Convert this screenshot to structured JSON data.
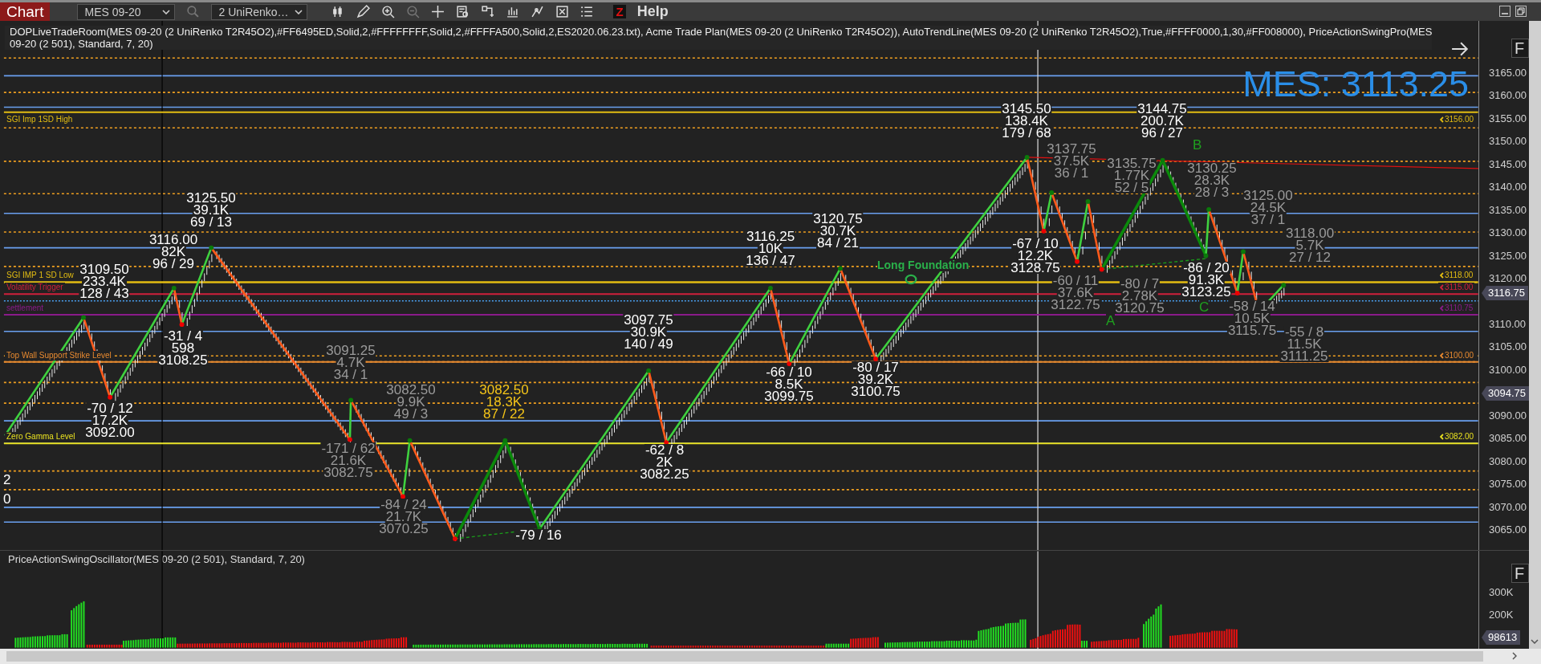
{
  "toolbar": {
    "tab": "Chart",
    "instrument": "MES 09-20",
    "bar_type": "2 UniRenko…",
    "z_logo": "Z",
    "help": "Help"
  },
  "indicator_lines": [
    "DOPLiveTradeRoom(MES 09-20 (2 UniRenko T2R45O2),#FF6495ED,Solid,2,#FFFFFFFF,Solid,2,#FFFFA500,Solid,2,ES2020.06.23.txt), Acme Trade Plan(MES 09-20 (2 UniRenko T2R45O2)), AutoTrendLine(MES 09-20 (2 UniRenko T2R45O2),True,#FFFF0000,1,30,#FF008000), PriceActionSwingPro(MES",
    "09-20 (2 501), Standard, 7, 20)"
  ],
  "price_banner": "MES: 3113.25",
  "levels": [
    {
      "label": "SGI Imp 1SD High",
      "tag": "3156.00",
      "color": "#e3bd12"
    },
    {
      "label": "SGI IMP 1 SD Low",
      "tag": "3118.00",
      "color": "#e3bd12"
    },
    {
      "label": "Volatility Trigger",
      "tag": "3115.00",
      "color": "#d0203c"
    },
    {
      "label": "settlement",
      "tag": "3110.75",
      "color": "#8a1a8a"
    },
    {
      "label": "Top Wall Support Strike Level",
      "tag": "3100.00",
      "color": "#e88a30"
    },
    {
      "label": "Zero Gamma Level",
      "tag": "3082.00",
      "color": "#e8e020"
    }
  ],
  "swing_labels": [
    {
      "kind": "bright",
      "lines": [
        "3109.50",
        "233.4K",
        "128 / 43"
      ]
    },
    {
      "kind": "bright",
      "lines": [
        "3116.00",
        "82K",
        "96 / 29"
      ]
    },
    {
      "kind": "bright",
      "lines": [
        "3125.50",
        "39.1K",
        "69 / 13"
      ]
    },
    {
      "kind": "bright",
      "lines": [
        "-31 / 4",
        "598",
        "3108.25"
      ]
    },
    {
      "kind": "bright",
      "lines": [
        "-70 / 12",
        "17.2K",
        "3092.00"
      ]
    },
    {
      "kind": "dim",
      "lines": [
        "3091.25",
        "4.7K",
        "34 / 1"
      ]
    },
    {
      "kind": "dim",
      "lines": [
        "3082.50",
        "9.9K",
        "49 / 3"
      ]
    },
    {
      "kind": "accent",
      "lines": [
        "3082.50",
        "18.3K",
        "87 / 22"
      ]
    },
    {
      "kind": "dim",
      "lines": [
        "-171 / 62",
        "21.6K",
        "3082.75"
      ]
    },
    {
      "kind": "dim",
      "lines": [
        "-84 / 24",
        "21.7K",
        "3070.25"
      ]
    },
    {
      "kind": "bright",
      "lines": [
        "-79 / 16"
      ]
    },
    {
      "kind": "bright",
      "lines": [
        "3097.75",
        "30.9K",
        "140 / 49"
      ]
    },
    {
      "kind": "bright",
      "lines": [
        "-62 / 8",
        "2K",
        "3082.25"
      ]
    },
    {
      "kind": "bright",
      "lines": [
        "3116.25",
        "10K",
        "136 / 47"
      ]
    },
    {
      "kind": "bright",
      "lines": [
        "3120.75",
        "30.7K",
        "84 / 21"
      ]
    },
    {
      "kind": "bright",
      "lines": [
        "-66 / 10",
        "8.5K",
        "3099.75"
      ]
    },
    {
      "kind": "bright",
      "lines": [
        "-80 / 17",
        "39.2K",
        "3100.75"
      ]
    },
    {
      "kind": "bright",
      "lines": [
        "3145.50",
        "138.4K",
        "179 / 68"
      ]
    },
    {
      "kind": "bright",
      "lines": [
        "3144.75",
        "200.7K",
        "96 / 27"
      ]
    },
    {
      "kind": "dim",
      "lines": [
        "3137.75",
        "37.5K",
        "36 / 1"
      ]
    },
    {
      "kind": "dim",
      "lines": [
        "3135.75",
        "1.77K",
        "52 / 5"
      ]
    },
    {
      "kind": "dim",
      "lines": [
        "3130.25",
        "28.3K",
        "28 / 3"
      ]
    },
    {
      "kind": "dim",
      "lines": [
        "3125.00",
        "24.5K",
        "37 / 1"
      ]
    },
    {
      "kind": "dim",
      "lines": [
        "3118.00",
        "5.7K",
        "27 / 12"
      ]
    },
    {
      "kind": "bright",
      "lines": [
        "-67 / 10",
        "12.2K",
        "3128.75"
      ]
    },
    {
      "kind": "dim",
      "lines": [
        "-60 / 11",
        "37.6K",
        "3122.75"
      ]
    },
    {
      "kind": "dim",
      "lines": [
        "-80 / 7",
        "2.78K",
        "3120.75"
      ]
    },
    {
      "kind": "bright",
      "lines": [
        "-86 / 20",
        "91.3K",
        "3123.25"
      ]
    },
    {
      "kind": "dim",
      "lines": [
        "-58 / 14",
        "10.5K",
        "3115.75"
      ]
    },
    {
      "kind": "dim",
      "lines": [
        "-55 / 8",
        "11.5K",
        "3111.25"
      ]
    }
  ],
  "wave_letters": [
    "A",
    "B",
    "C"
  ],
  "signal_label": "Long Foundation",
  "left_marks": [
    "2",
    "0"
  ],
  "price_axis": {
    "ticks": [
      "3165.00",
      "3160.00",
      "3155.00",
      "3150.00",
      "3145.00",
      "3140.00",
      "3135.00",
      "3130.00",
      "3125.00",
      "3120.00",
      "3110.00",
      "3105.00",
      "3100.00",
      "3090.00",
      "3085.00",
      "3080.00",
      "3075.00",
      "3070.00",
      "3065.00"
    ],
    "tags": [
      "3116.75",
      "3094.75"
    ]
  },
  "oscillator": {
    "title": "PriceActionSwingOscillator(MES 09-20 (2 501), Standard, 7, 20)",
    "ticks": [
      "300K",
      "200K"
    ],
    "tag": "98613"
  },
  "panel_buttons": [
    "F",
    "F"
  ]
}
